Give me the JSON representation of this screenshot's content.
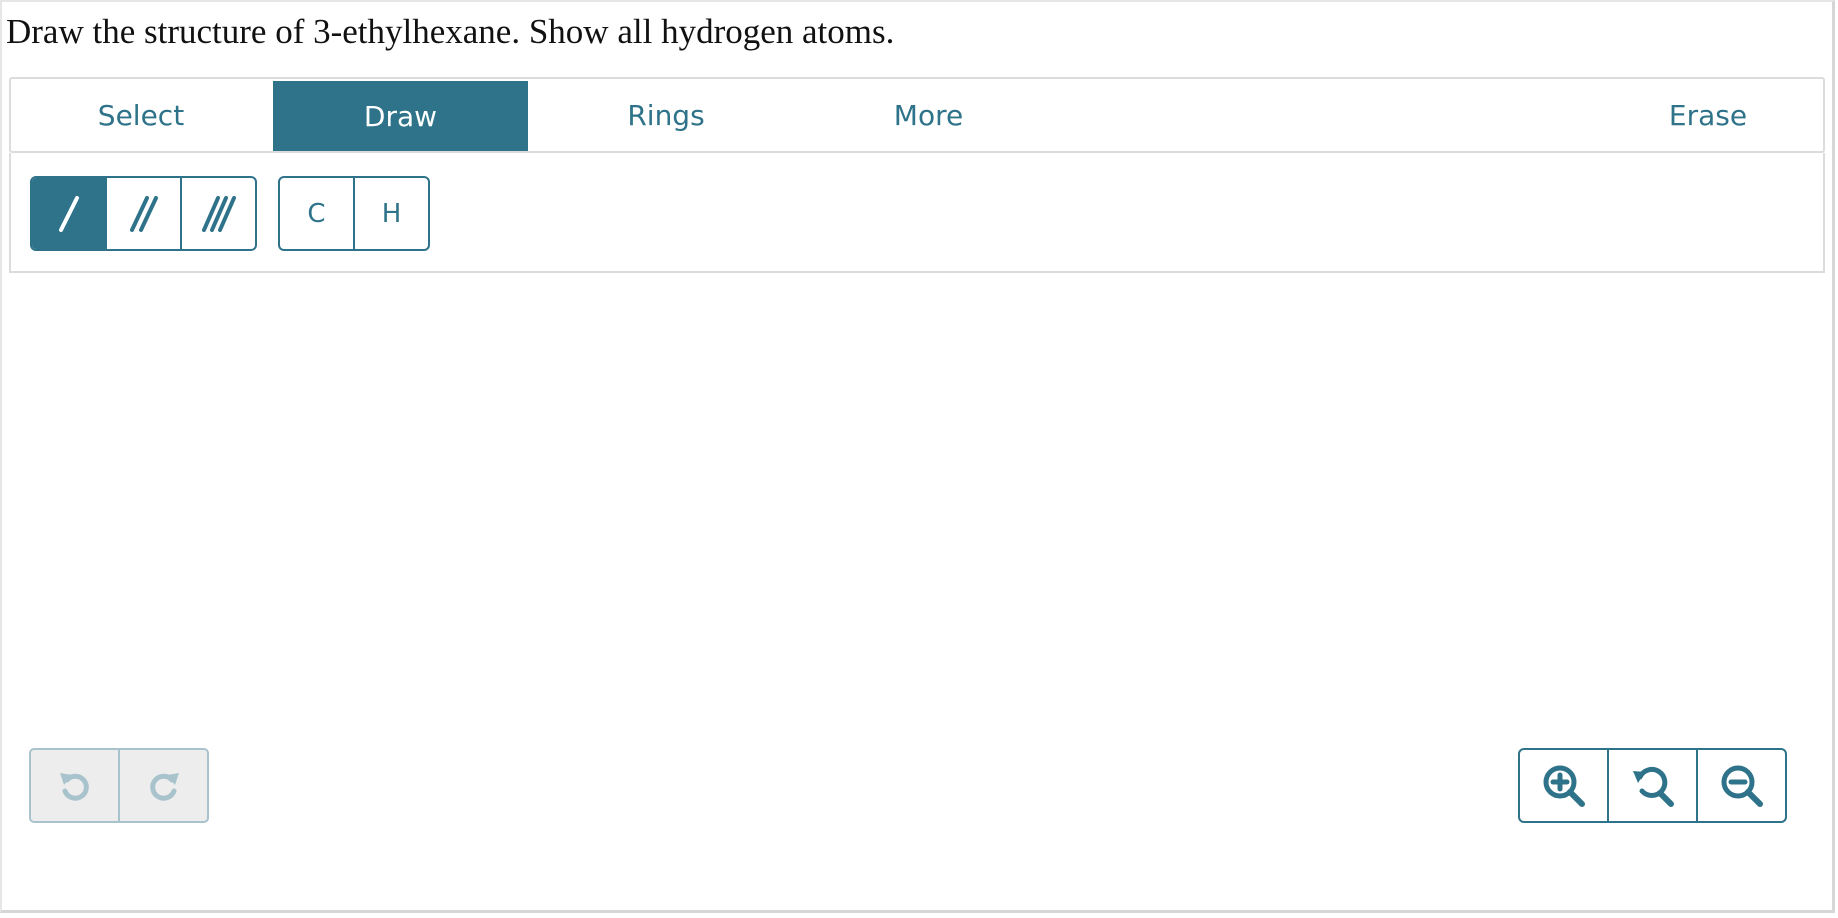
{
  "question": {
    "text": "Draw the structure of 3-ethylhexane. Show all hydrogen atoms."
  },
  "tabs": [
    {
      "label": "Select",
      "active": false
    },
    {
      "label": "Draw",
      "active": true
    },
    {
      "label": "Rings",
      "active": false
    },
    {
      "label": "More",
      "active": false
    },
    {
      "label": "Erase",
      "active": false
    }
  ],
  "bond_tools": [
    {
      "icon": "single-bond-icon",
      "active": true
    },
    {
      "icon": "double-bond-icon",
      "active": false
    },
    {
      "icon": "triple-bond-icon",
      "active": false
    }
  ],
  "atom_tools": [
    {
      "label": "C"
    },
    {
      "label": "H"
    }
  ],
  "history_controls": [
    {
      "icon": "undo-icon",
      "enabled": false
    },
    {
      "icon": "redo-icon",
      "enabled": false
    }
  ],
  "zoom_controls": [
    {
      "icon": "zoom-in-icon"
    },
    {
      "icon": "zoom-reset-icon"
    },
    {
      "icon": "zoom-out-icon"
    }
  ],
  "colors": {
    "accent": "#2e7389",
    "disabled": "#a9c3cc",
    "border": "#dcdcdc"
  }
}
